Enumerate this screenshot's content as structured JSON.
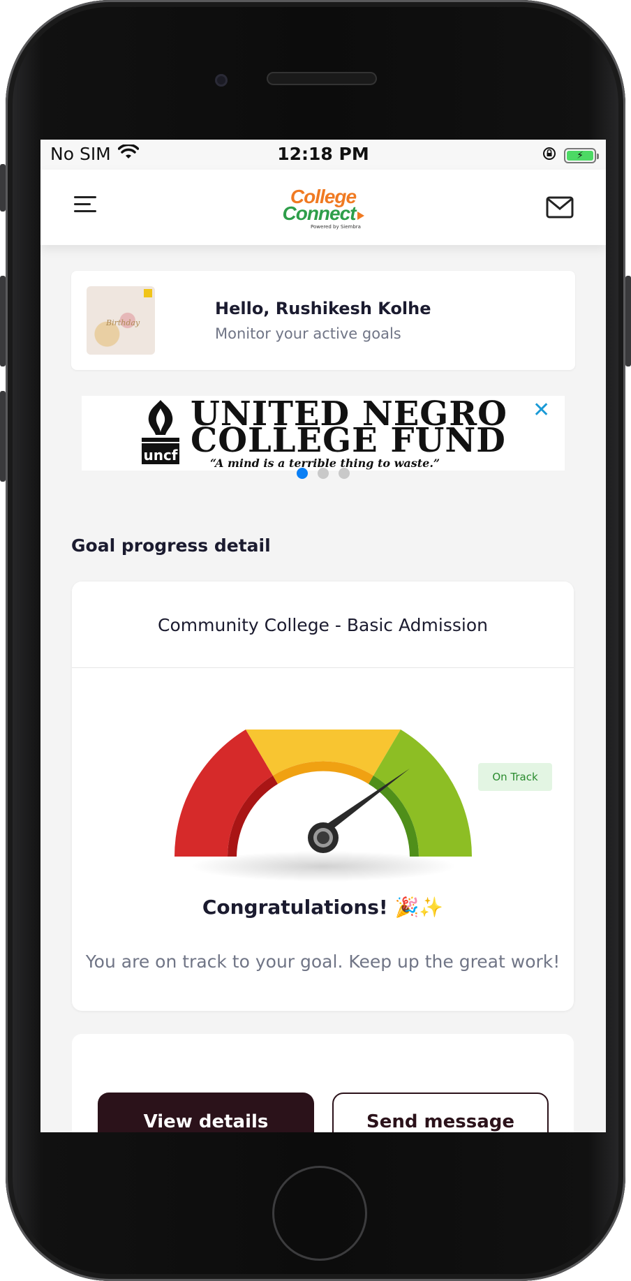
{
  "status_bar": {
    "carrier": "No SIM",
    "time": "12:18 PM",
    "icons": [
      "wifi-icon",
      "orientation-lock-icon",
      "battery-charging-icon"
    ]
  },
  "header": {
    "logo_word1": "College",
    "logo_word2": "Connect",
    "logo_tagline": "Powered by Siembra",
    "menu_icon": "hamburger-menu-icon",
    "mail_icon": "mail-icon"
  },
  "hello_card": {
    "greeting": "Hello, Rushikesh Kolhe",
    "subtitle": "Monitor your active goals",
    "avatar_text": "Birthday"
  },
  "banner": {
    "line1": "UNITED NEGRO",
    "line2": "COLLEGE FUND",
    "tagline": "“A mind is a terrible thing to waste.”",
    "logo_text": "uncf",
    "close_icon": "✕",
    "slides": 3,
    "active_slide": 1
  },
  "section": {
    "title": "Goal progress detail"
  },
  "goal_card": {
    "title": "Community College - Basic Admission",
    "status_badge": "On Track",
    "gauge_level": 0.8,
    "colors": {
      "red": "#d62a2a",
      "yellow": "#f8c531",
      "green": "#8dbe24"
    },
    "congrats": "Congratulations! 🎉✨",
    "message": "You are on track to your goal. Keep up the great work!"
  },
  "actions": {
    "view_details": "View details",
    "send_message": "Send message"
  }
}
